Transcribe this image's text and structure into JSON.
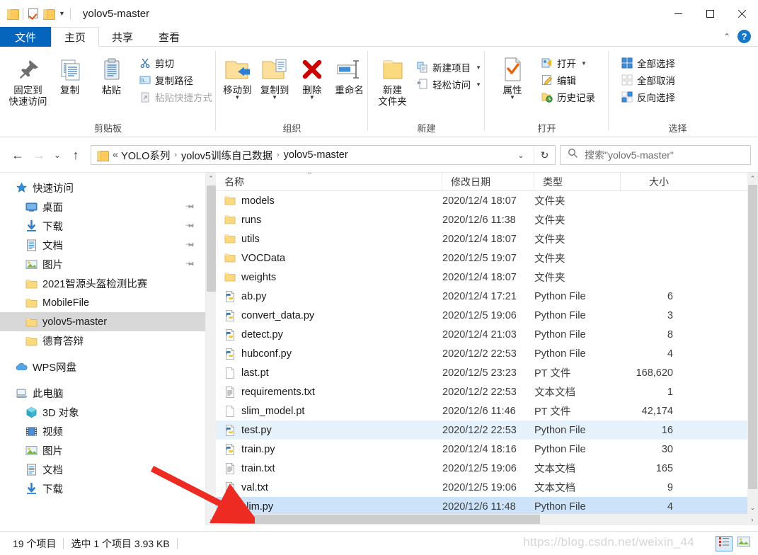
{
  "window": {
    "title": "yolov5-master",
    "quick_access": [
      "folder-icon",
      "checkbox-icon",
      "folder-icon",
      "caret-down-icon"
    ],
    "controls": {
      "minimize": "minimize-icon",
      "maximize": "maximize-icon",
      "close": "close-icon"
    }
  },
  "tabs": [
    {
      "label": "文件",
      "name": "tab-file"
    },
    {
      "label": "主页",
      "name": "tab-home"
    },
    {
      "label": "共享",
      "name": "tab-share"
    },
    {
      "label": "查看",
      "name": "tab-view"
    }
  ],
  "ribbon": {
    "collapse_icon": "chevron-up-icon",
    "help_icon": "help-icon",
    "help_label": "?",
    "groups": [
      {
        "label": "剪贴板",
        "big": [
          {
            "label": "固定到\n快速访问",
            "line1": "固定到",
            "line2": "快速访问",
            "icon": "pin-icon"
          },
          {
            "label": "复制",
            "line1": "复制",
            "line2": "",
            "icon": "copy-icon"
          },
          {
            "label": "粘贴",
            "line1": "粘贴",
            "line2": "",
            "icon": "paste-icon"
          }
        ],
        "small": [
          {
            "label": "剪切",
            "icon": "scissors-icon",
            "disabled": false
          },
          {
            "label": "复制路径",
            "icon": "copy-path-icon",
            "disabled": false
          },
          {
            "label": "粘贴快捷方式",
            "icon": "paste-shortcut-icon",
            "disabled": true
          }
        ]
      },
      {
        "label": "组织",
        "big": [
          {
            "line1": "移动到",
            "line2": "",
            "icon": "move-to-icon",
            "caret": true
          },
          {
            "line1": "复制到",
            "line2": "",
            "icon": "copy-to-icon",
            "caret": true
          },
          {
            "line1": "删除",
            "line2": "",
            "icon": "delete-icon",
            "caret": true
          },
          {
            "line1": "重命名",
            "line2": "",
            "icon": "rename-icon",
            "caret": false
          }
        ],
        "small": []
      },
      {
        "label": "新建",
        "big": [
          {
            "line1": "新建",
            "line2": "文件夹",
            "icon": "new-folder-icon",
            "caret": false
          }
        ],
        "small": [
          {
            "label": "新建项目",
            "icon": "new-item-icon",
            "caret": true
          },
          {
            "label": "轻松访问",
            "icon": "easy-access-icon",
            "caret": true
          }
        ]
      },
      {
        "label": "打开",
        "big": [
          {
            "line1": "属性",
            "line2": "",
            "icon": "properties-icon",
            "caret": true
          }
        ],
        "small": [
          {
            "label": "打开",
            "icon": "open-icon",
            "caret": true
          },
          {
            "label": "编辑",
            "icon": "edit-icon",
            "caret": false
          },
          {
            "label": "历史记录",
            "icon": "history-icon",
            "caret": false
          }
        ]
      },
      {
        "label": "选择",
        "big": [],
        "small": [
          {
            "label": "全部选择",
            "icon": "select-all-icon"
          },
          {
            "label": "全部取消",
            "icon": "select-none-icon"
          },
          {
            "label": "反向选择",
            "icon": "invert-selection-icon"
          }
        ]
      }
    ]
  },
  "addressbar": {
    "back_icon": "back-arrow-icon",
    "forward_icon": "forward-arrow-icon",
    "recent_icon": "chevron-down-icon",
    "up_icon": "up-arrow-icon",
    "folder_icon": "folder-icon",
    "prefix": "«",
    "crumbs": [
      "YOLO系列",
      "yolov5训练自己数据",
      "yolov5-master"
    ],
    "separator": "›",
    "dropdown_icon": "chevron-down-icon",
    "refresh_icon": "refresh-icon",
    "search": {
      "icon": "search-icon",
      "placeholder": "搜索\"yolov5-master\""
    }
  },
  "navpane": {
    "items": [
      {
        "label": "快速访问",
        "icon": "quick-access-star-icon",
        "indent": false,
        "pin": false,
        "selected": false
      },
      {
        "label": "桌面",
        "icon": "desktop-icon",
        "indent": true,
        "pin": true,
        "selected": false
      },
      {
        "label": "下载",
        "icon": "downloads-icon",
        "indent": true,
        "pin": true,
        "selected": false
      },
      {
        "label": "文档",
        "icon": "documents-icon",
        "indent": true,
        "pin": true,
        "selected": false
      },
      {
        "label": "图片",
        "icon": "pictures-icon",
        "indent": true,
        "pin": true,
        "selected": false
      },
      {
        "label": "2021智源头盔检测比赛",
        "icon": "folder-icon",
        "indent": true,
        "pin": false,
        "selected": false
      },
      {
        "label": "MobileFile",
        "icon": "folder-icon",
        "indent": true,
        "pin": false,
        "selected": false
      },
      {
        "label": "yolov5-master",
        "icon": "folder-icon",
        "indent": true,
        "pin": false,
        "selected": true
      },
      {
        "label": "德育答辩",
        "icon": "folder-icon",
        "indent": true,
        "pin": false,
        "selected": false
      },
      {
        "label": "",
        "icon": "spacer",
        "indent": false,
        "pin": false,
        "selected": false
      },
      {
        "label": "WPS网盘",
        "icon": "cloud-icon",
        "indent": false,
        "pin": false,
        "selected": false
      },
      {
        "label": "",
        "icon": "spacer",
        "indent": false,
        "pin": false,
        "selected": false
      },
      {
        "label": "此电脑",
        "icon": "this-pc-icon",
        "indent": false,
        "pin": false,
        "selected": false
      },
      {
        "label": "3D 对象",
        "icon": "3d-objects-icon",
        "indent": true,
        "pin": false,
        "selected": false
      },
      {
        "label": "视频",
        "icon": "videos-icon",
        "indent": true,
        "pin": false,
        "selected": false
      },
      {
        "label": "图片",
        "icon": "pictures-icon",
        "indent": true,
        "pin": false,
        "selected": false
      },
      {
        "label": "文档",
        "icon": "documents-icon",
        "indent": true,
        "pin": false,
        "selected": false
      },
      {
        "label": "下载",
        "icon": "downloads-icon",
        "indent": true,
        "pin": false,
        "selected": false
      }
    ]
  },
  "filelist": {
    "columns": [
      {
        "label": "名称",
        "key": "name"
      },
      {
        "label": "修改日期",
        "key": "date"
      },
      {
        "label": "类型",
        "key": "type"
      },
      {
        "label": "大小",
        "key": "size"
      }
    ],
    "sort_indicator": "caret-up-icon",
    "rows": [
      {
        "name": "models",
        "date": "2020/12/4 18:07",
        "type": "文件夹",
        "size": "",
        "icon": "folder-icon",
        "state": ""
      },
      {
        "name": "runs",
        "date": "2020/12/6 11:38",
        "type": "文件夹",
        "size": "",
        "icon": "folder-icon",
        "state": ""
      },
      {
        "name": "utils",
        "date": "2020/12/4 18:07",
        "type": "文件夹",
        "size": "",
        "icon": "folder-icon",
        "state": ""
      },
      {
        "name": "VOCData",
        "date": "2020/12/5 19:07",
        "type": "文件夹",
        "size": "",
        "icon": "folder-icon",
        "state": ""
      },
      {
        "name": "weights",
        "date": "2020/12/4 18:07",
        "type": "文件夹",
        "size": "",
        "icon": "folder-icon",
        "state": ""
      },
      {
        "name": "ab.py",
        "date": "2020/12/4 17:21",
        "type": "Python File",
        "size": "6",
        "icon": "python-file-icon",
        "state": ""
      },
      {
        "name": "convert_data.py",
        "date": "2020/12/5 19:06",
        "type": "Python File",
        "size": "3",
        "icon": "python-file-icon",
        "state": ""
      },
      {
        "name": "detect.py",
        "date": "2020/12/4 21:03",
        "type": "Python File",
        "size": "8",
        "icon": "python-file-icon",
        "state": ""
      },
      {
        "name": "hubconf.py",
        "date": "2020/12/2 22:53",
        "type": "Python File",
        "size": "4",
        "icon": "python-file-icon",
        "state": ""
      },
      {
        "name": "last.pt",
        "date": "2020/12/5 23:23",
        "type": "PT 文件",
        "size": "168,620",
        "icon": "generic-file-icon",
        "state": ""
      },
      {
        "name": "requirements.txt",
        "date": "2020/12/2 22:53",
        "type": "文本文档",
        "size": "1",
        "icon": "text-file-icon",
        "state": ""
      },
      {
        "name": "slim_model.pt",
        "date": "2020/12/6 11:46",
        "type": "PT 文件",
        "size": "42,174",
        "icon": "generic-file-icon",
        "state": ""
      },
      {
        "name": "test.py",
        "date": "2020/12/2 22:53",
        "type": "Python File",
        "size": "16",
        "icon": "python-file-icon",
        "state": "sel2"
      },
      {
        "name": "train.py",
        "date": "2020/12/4 18:16",
        "type": "Python File",
        "size": "30",
        "icon": "python-file-icon",
        "state": ""
      },
      {
        "name": "train.txt",
        "date": "2020/12/5 19:06",
        "type": "文本文档",
        "size": "165",
        "icon": "text-file-icon",
        "state": ""
      },
      {
        "name": "val.txt",
        "date": "2020/12/5 19:06",
        "type": "文本文档",
        "size": "9",
        "icon": "text-file-icon",
        "state": ""
      },
      {
        "name": "slim.py",
        "date": "2020/12/6 11:48",
        "type": "Python File",
        "size": "4",
        "icon": "python-file-icon",
        "state": "sel"
      }
    ]
  },
  "statusbar": {
    "item_count": "19 个项目",
    "selection": "选中 1 个项目  3.93 KB",
    "view_details_icon": "details-view-icon",
    "view_large_icon": "large-icons-view-icon"
  },
  "watermark": "https://blog.csdn.net/weixin_44",
  "annotation": {
    "type": "red-arrow",
    "color": "#ee2b23"
  }
}
